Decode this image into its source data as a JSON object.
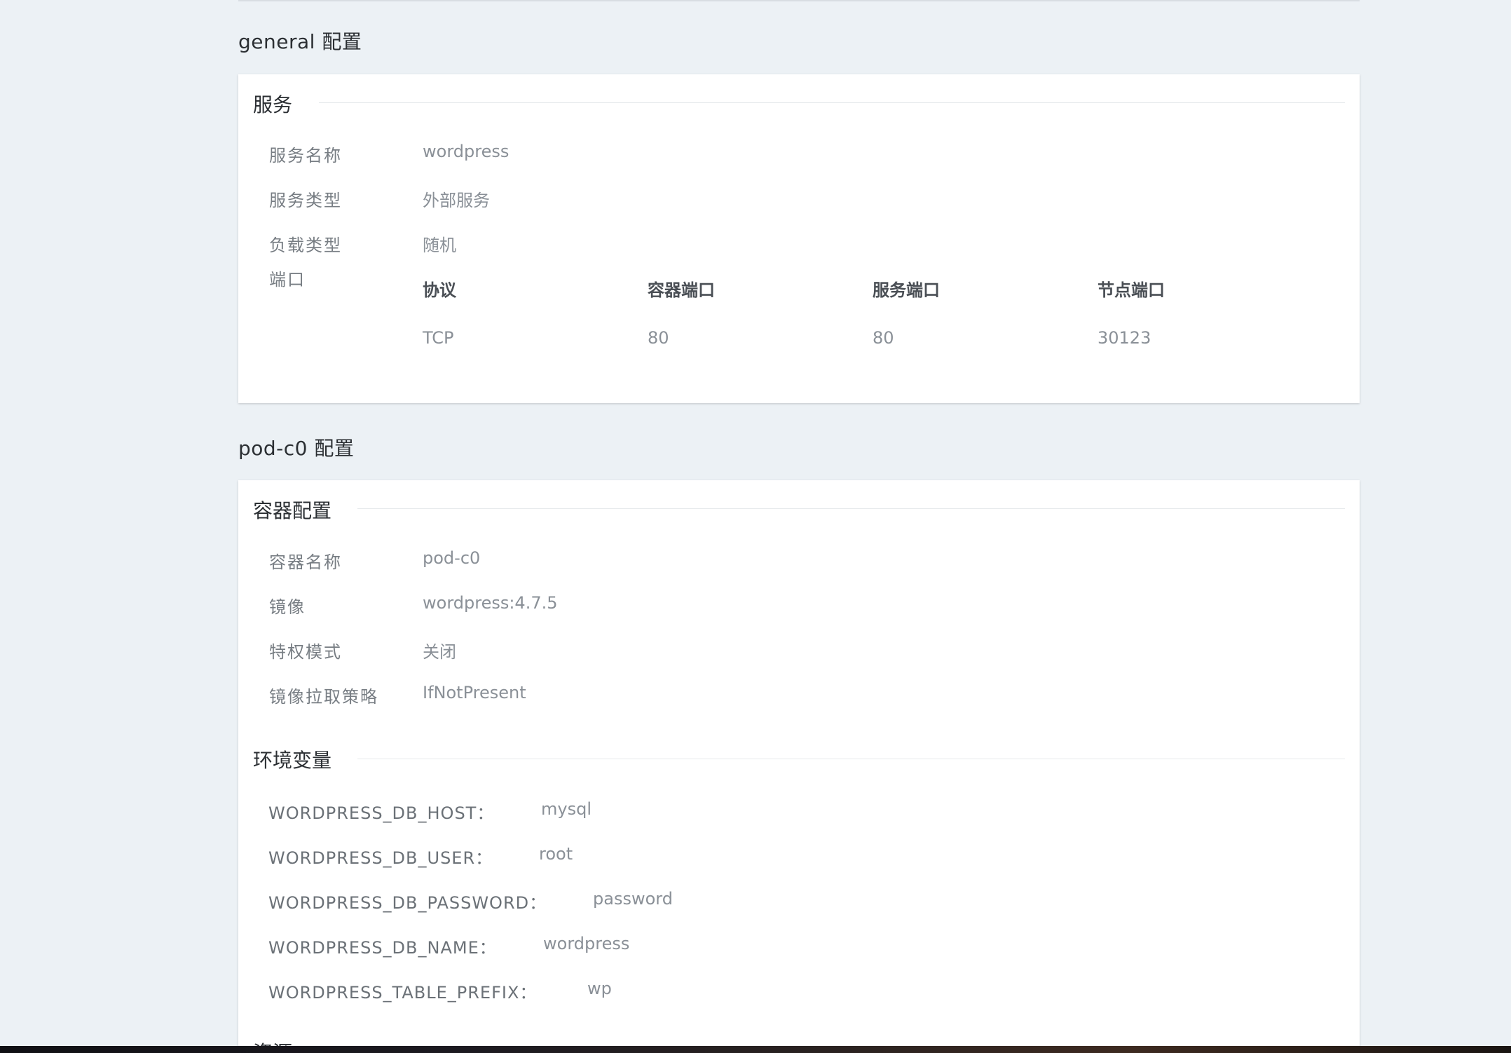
{
  "general": {
    "heading": "general 配置",
    "service_fieldset": {
      "title": "服务",
      "fields": [
        {
          "label": "服务名称",
          "value": "wordpress"
        },
        {
          "label": "服务类型",
          "value": "外部服务"
        },
        {
          "label": "负载类型",
          "value": "随机"
        }
      ],
      "ports": {
        "label": "端口",
        "headers": [
          "协议",
          "容器端口",
          "服务端口",
          "节点端口"
        ],
        "rows": [
          [
            "TCP",
            "80",
            "80",
            "30123"
          ]
        ]
      }
    }
  },
  "pod": {
    "heading": "pod-c0 配置",
    "container_fieldset": {
      "title": "容器配置",
      "fields": [
        {
          "label": "容器名称",
          "value": "pod-c0"
        },
        {
          "label": "镜像",
          "value": "wordpress:4.7.5"
        },
        {
          "label": "特权模式",
          "value": "关闭"
        },
        {
          "label": "镜像拉取策略",
          "value": "IfNotPresent"
        }
      ]
    },
    "env_fieldset": {
      "title": "环境变量",
      "vars": [
        {
          "key": "WORDPRESS_DB_HOST：",
          "value": "mysql"
        },
        {
          "key": "WORDPRESS_DB_USER：",
          "value": "root"
        },
        {
          "key": "WORDPRESS_DB_PASSWORD：",
          "value": "password"
        },
        {
          "key": "WORDPRESS_DB_NAME：",
          "value": "wordpress"
        },
        {
          "key": "WORDPRESS_TABLE_PREFIX：",
          "value": "wp"
        }
      ]
    },
    "next_fieldset": {
      "title": "资源"
    }
  }
}
